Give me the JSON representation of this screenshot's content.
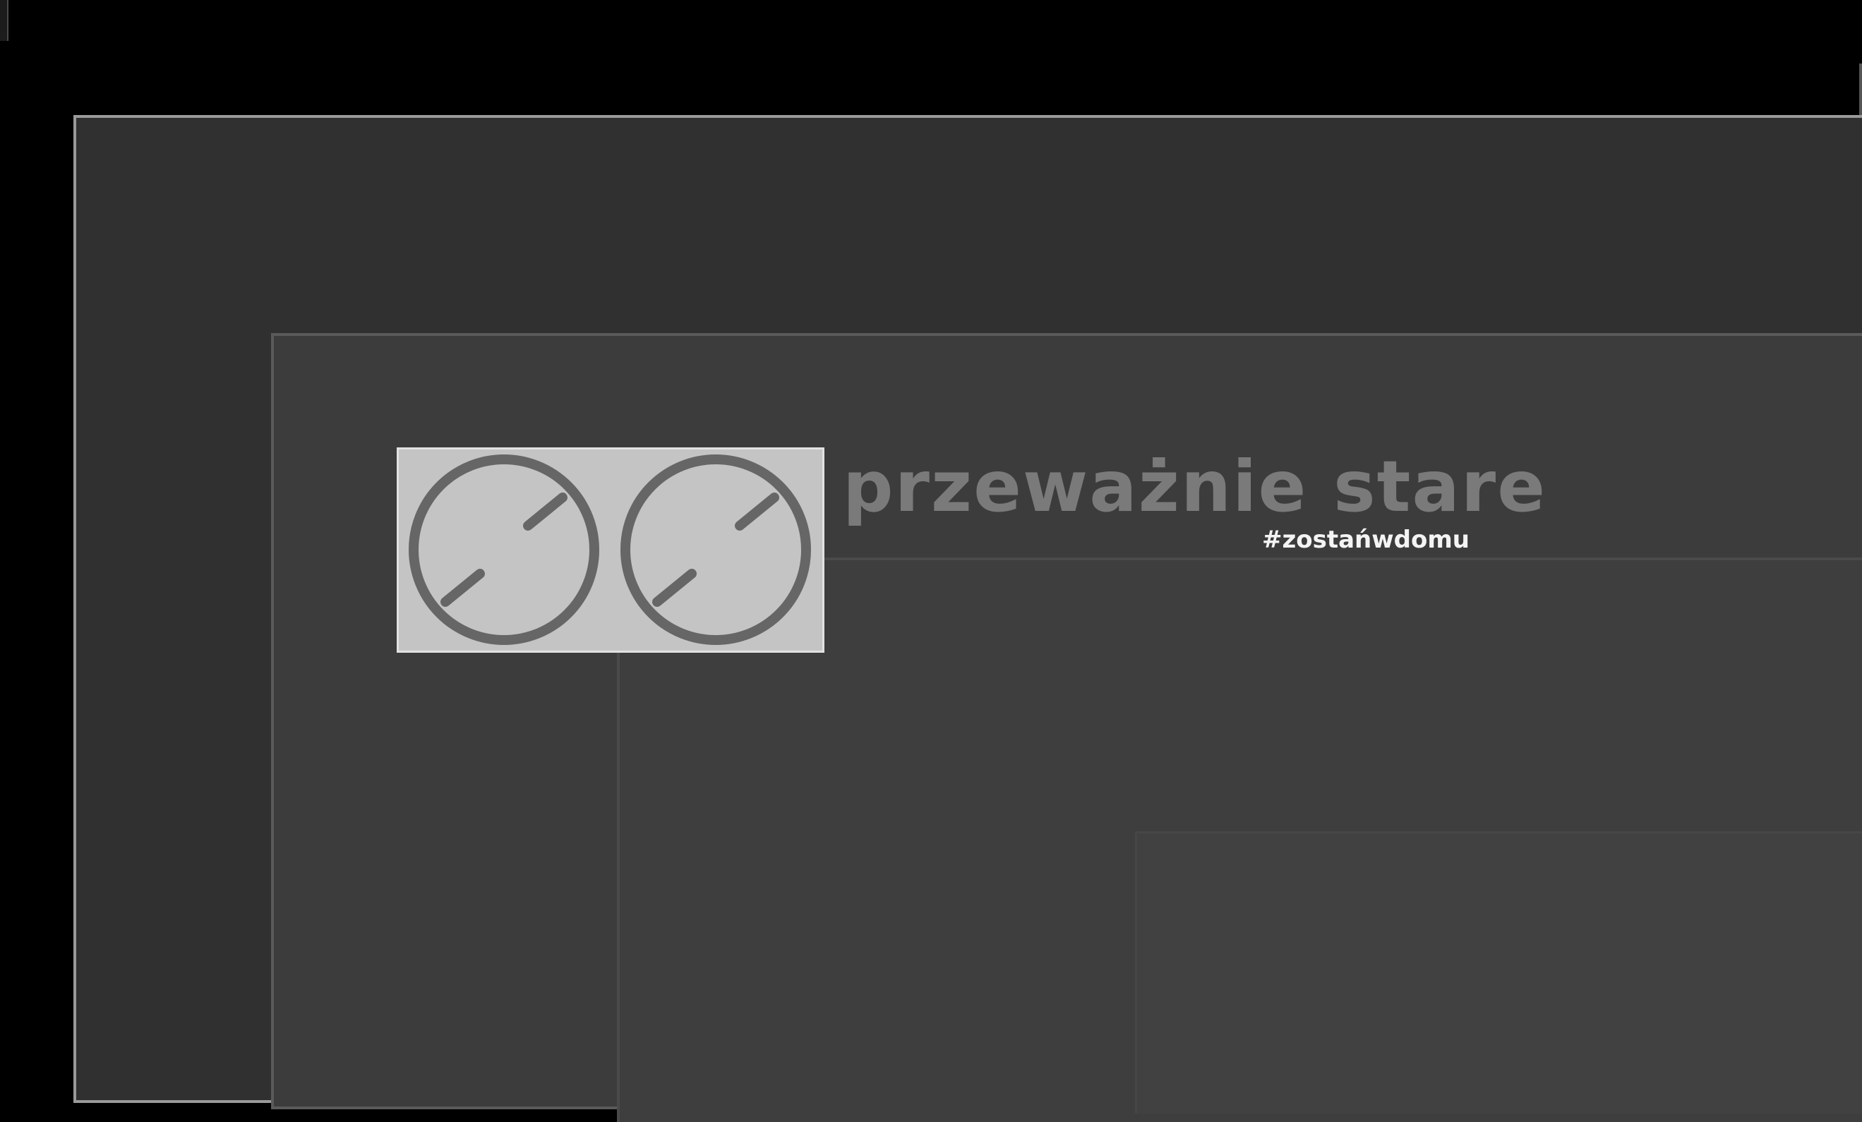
{
  "header": {
    "site_title": "przeważnie stare",
    "tagline": "#zostańwdomu",
    "logo_icon": "twin-knob-dials-icon"
  },
  "colors": {
    "page_background": "#000000",
    "outer_frame": "#303030",
    "inner_frame": "#3c3c3c",
    "title_text": "#7a7a7a",
    "tagline_text": "#f4f4f4",
    "logo_background": "#c4c4c4",
    "logo_stroke": "#666666"
  }
}
